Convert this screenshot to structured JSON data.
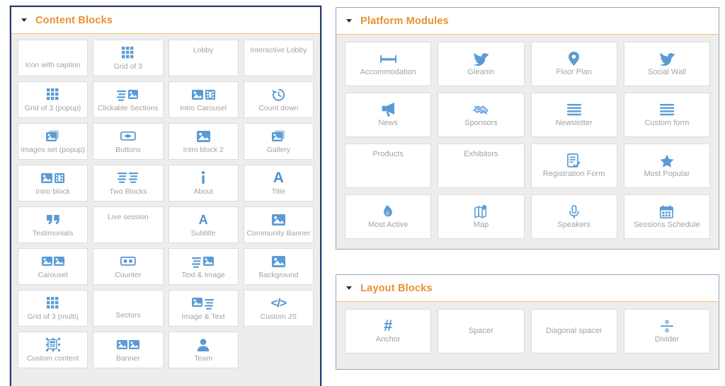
{
  "theme": {
    "panel_title_color": "#e8912f",
    "panel_selected_border": "#29376b",
    "header_underline": "#f2c66a",
    "tile_icon_color": "#5b9bd5",
    "tile_label_color": "#a3a3a3",
    "panel_body_bg": "#ededed",
    "tile_bg": "#ffffff",
    "tile_border": "#dcdcdc"
  },
  "panels": [
    {
      "id": "content-blocks",
      "title": "Content Blocks",
      "collapse_icon": "caret-down-icon",
      "collapsed": false,
      "selected": true,
      "columns": 4,
      "tiles": [
        {
          "label": "Icon with caption",
          "icon": null,
          "label_position": "low"
        },
        {
          "label": "Grid of 3",
          "icon": "grid-of-three-icon"
        },
        {
          "label": "Lobby",
          "icon": null,
          "label_position": "top"
        },
        {
          "label": "Interactive Lobby",
          "icon": null,
          "label_position": "top"
        },
        {
          "label": "Grid of 3 (popup)",
          "icon": "grid-of-three-icon"
        },
        {
          "label": "Clickable Sections",
          "icon": "lines-and-image-icon"
        },
        {
          "label": "Intro Carousel",
          "icon": "image-and-film-icon"
        },
        {
          "label": "Count down",
          "icon": "clock-rewind-icon"
        },
        {
          "label": "Images set (popup)",
          "icon": "image-stack-icon"
        },
        {
          "label": "Buttons",
          "icon": "button-icon"
        },
        {
          "label": "Intro block 2",
          "icon": "image-icon"
        },
        {
          "label": "Gallery",
          "icon": "image-stack-icon"
        },
        {
          "label": "Intro block",
          "icon": "image-and-film-icon"
        },
        {
          "label": "Two Blocks",
          "icon": "two-text-blocks-icon"
        },
        {
          "label": "About",
          "icon": "info-icon"
        },
        {
          "label": "Title",
          "icon": "letter-a-large-icon"
        },
        {
          "label": "Testimonials",
          "icon": "quote-marks-icon"
        },
        {
          "label": "Live session",
          "icon": null,
          "label_position": "top"
        },
        {
          "label": "Subtitle",
          "icon": "letter-a-small-icon"
        },
        {
          "label": "Community Banner",
          "icon": "image-icon"
        },
        {
          "label": "Carousel",
          "icon": "two-images-icon"
        },
        {
          "label": "Counter",
          "icon": "counter-icon"
        },
        {
          "label": "Text & Image",
          "icon": "text-then-image-icon"
        },
        {
          "label": "Background",
          "icon": "image-icon"
        },
        {
          "label": "Grid of 3 (multi)",
          "icon": "grid-of-three-icon"
        },
        {
          "label": "Sectors",
          "icon": null,
          "label_position": "low"
        },
        {
          "label": "Image & Text",
          "icon": "image-then-text-icon"
        },
        {
          "label": "Custom JS",
          "icon": "code-brackets-icon"
        },
        {
          "label": "Custom content",
          "icon": "custom-content-icon"
        },
        {
          "label": "Banner",
          "icon": "two-images-icon"
        },
        {
          "label": "Team",
          "icon": "person-icon"
        },
        {
          "label": "",
          "icon": null,
          "empty": true
        }
      ]
    },
    {
      "id": "platform-modules",
      "title": "Platform Modules",
      "collapse_icon": "caret-down-icon",
      "collapsed": false,
      "selected": false,
      "columns": 4,
      "tiles": [
        {
          "label": "Accommodation",
          "icon": "bed-icon"
        },
        {
          "label": "Gleanin",
          "icon": "twitter-bird-icon"
        },
        {
          "label": "Floor Plan",
          "icon": "map-pin-icon"
        },
        {
          "label": "Social Wall",
          "icon": "twitter-bird-icon"
        },
        {
          "label": "News",
          "icon": "megaphone-icon"
        },
        {
          "label": "Sponsors",
          "icon": "handshake-icon"
        },
        {
          "label": "Newsletter",
          "icon": "list-lines-icon"
        },
        {
          "label": "Custom form",
          "icon": "list-lines-icon"
        },
        {
          "label": "Products",
          "icon": null,
          "label_position": "top"
        },
        {
          "label": "Exhibitors",
          "icon": null,
          "label_position": "top"
        },
        {
          "label": "Registration Form",
          "icon": "clipboard-check-icon"
        },
        {
          "label": "Most Popular",
          "icon": "star-icon"
        },
        {
          "label": "Most Active",
          "icon": "flame-icon"
        },
        {
          "label": "Map",
          "icon": "folded-map-icon"
        },
        {
          "label": "Speakers",
          "icon": "microphone-icon"
        },
        {
          "label": "Sessions Schedule",
          "icon": "calendar-icon"
        }
      ]
    },
    {
      "id": "layout-blocks",
      "title": "Layout Blocks",
      "collapse_icon": "caret-down-icon",
      "collapsed": false,
      "selected": false,
      "columns": 4,
      "tiles": [
        {
          "label": "Anchor",
          "icon": "hash-icon"
        },
        {
          "label": "Spacer",
          "icon": null,
          "label_position": "middle"
        },
        {
          "label": "Diagonal spacer",
          "icon": null,
          "label_position": "middle"
        },
        {
          "label": "Divider",
          "icon": "divide-icon"
        }
      ]
    }
  ]
}
